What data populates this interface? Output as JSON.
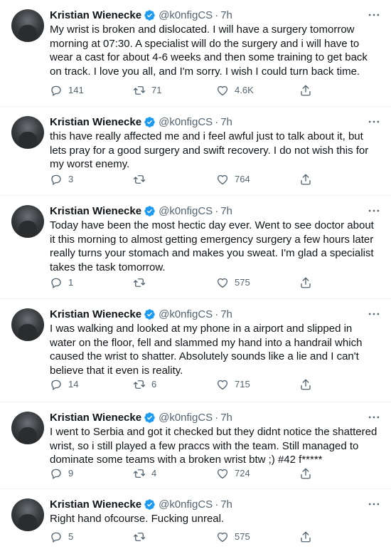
{
  "tweets": [
    {
      "author": "Kristian Wienecke",
      "handle": "@k0nfigCS",
      "time": "7h",
      "text": "My wrist is broken and dislocated. I will have a surgery tomorrow morning at 07:30. A specialist will do the surgery and i will have to wear a cast for about 4-6 weeks and then some training to get back on track. I love you all, and I'm sorry. I wish I could turn back time.",
      "replies": "141",
      "retweets": "71",
      "likes": "4.6K"
    },
    {
      "author": "Kristian Wienecke",
      "handle": "@k0nfigCS",
      "time": "7h",
      "text": "this have really affected me and i feel awful just to talk about it, but lets pray for a good surgery and swift recovery. I do not wish this for my worst enemy.",
      "replies": "3",
      "retweets": "",
      "likes": "764"
    },
    {
      "author": "Kristian Wienecke",
      "handle": "@k0nfigCS",
      "time": "7h",
      "text": "Today have been the most hectic day ever. Went to see doctor about it this morning to almost getting emergency surgery a few hours later really turns your stomach and makes you sweat. I'm glad a specialist takes the task tomorrow.",
      "replies": "1",
      "retweets": "",
      "likes": "575"
    },
    {
      "author": "Kristian Wienecke",
      "handle": "@k0nfigCS",
      "time": "7h",
      "text": "I was walking and looked at my phone in a airport and slipped in water on the floor, fell and slammed my hand into a handrail which caused the wrist to shatter. Absolutely sounds like a lie and I can't believe that it even is reality.",
      "replies": "14",
      "retweets": "6",
      "likes": "715"
    },
    {
      "author": "Kristian Wienecke",
      "handle": "@k0nfigCS",
      "time": "7h",
      "text": "I went to Serbia and got it checked but they didnt notice the shattered wrist, so i still played a few praccs with the team. Still managed to dominate some teams with a broken wrist btw ;) #42 f*****",
      "replies": "9",
      "retweets": "4",
      "likes": "724"
    },
    {
      "author": "Kristian Wienecke",
      "handle": "@k0nfigCS",
      "time": "7h",
      "text": "Right hand ofcourse. Fucking unreal.",
      "replies": "5",
      "retweets": "",
      "likes": "575"
    }
  ],
  "separator": "·",
  "colors": {
    "verified": "#1d9bf0",
    "muted": "#536471",
    "text": "#0f1419",
    "divider": "#eff3f4"
  },
  "icons": {
    "verified": "verified-badge-icon",
    "more": "more-options-icon",
    "reply": "reply-icon",
    "retweet": "retweet-icon",
    "like": "like-icon",
    "share": "share-icon"
  }
}
